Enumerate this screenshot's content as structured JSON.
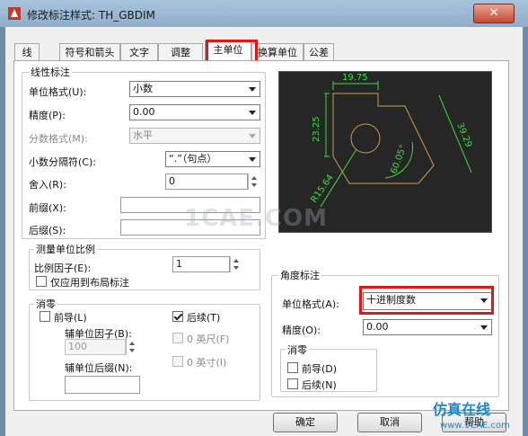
{
  "window": {
    "title": "修改标注样式: TH_GBDIM",
    "close_glyph": "✕"
  },
  "tabs": [
    "线",
    "符号和箭头",
    "文字",
    "调整",
    "主单位",
    "换算单位",
    "公差"
  ],
  "active_tab": "主单位",
  "linear": {
    "group_title": "线性标注",
    "unit_format_label": "单位格式(U):",
    "unit_format_value": "小数",
    "precision_label": "精度(P):",
    "precision_value": "0.00",
    "fraction_format_label": "分数格式(M):",
    "fraction_format_value": "水平",
    "decimal_sep_label": "小数分隔符(C):",
    "decimal_sep_value": "“.”（句点）",
    "roundoff_label": "舍入(R):",
    "roundoff_value": "0",
    "prefix_label": "前缀(X):",
    "prefix_value": "",
    "suffix_label": "后缀(S):",
    "suffix_value": ""
  },
  "scale": {
    "group_title": "测量单位比例",
    "factor_label": "比例因子(E):",
    "factor_value": "1",
    "layout_only_label": "仅应用到布局标注",
    "layout_only_checked": false
  },
  "zero_suppress_linear": {
    "group_title": "消零",
    "leading_label": "前导(L)",
    "leading_checked": false,
    "trailing_label": "后续(T)",
    "trailing_checked": true,
    "sub_factor_label": "辅单位因子(B):",
    "sub_factor_value": "100",
    "sub_suffix_label": "辅单位后缀(N):",
    "sub_suffix_value": "",
    "feet_label": "0 英尺(F)",
    "inches_label": "0 英寸(I)"
  },
  "angular": {
    "group_title": "角度标注",
    "unit_format_label": "单位格式(A):",
    "unit_format_value": "十进制度数",
    "precision_label": "精度(O):",
    "precision_value": "0.00",
    "zero_title": "消零",
    "leading_label": "前导(D)",
    "leading_checked": false,
    "trailing_label": "后续(N)",
    "trailing_checked": false
  },
  "preview": {
    "dims": [
      "19.75",
      "23.25",
      "39.29",
      "60.05°",
      "R15.64"
    ],
    "line_color": "#c8a04a",
    "dim_color": "#3ddc3d",
    "bg_color": "#262626"
  },
  "buttons": {
    "ok": "确定",
    "cancel": "取消",
    "help": "帮助"
  },
  "watermarks": {
    "center": "1CAE.COM",
    "brand": "仿真在线",
    "brand_url": "www.1CAE.com"
  },
  "highlight_color": "#e01818"
}
